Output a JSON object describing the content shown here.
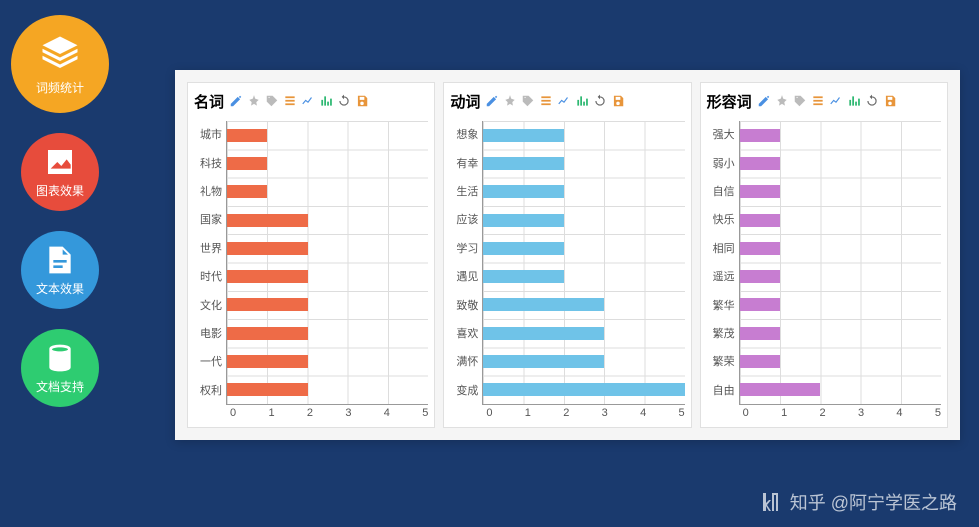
{
  "sidebar": {
    "items": [
      {
        "label": "词频统计"
      },
      {
        "label": "图表效果"
      },
      {
        "label": "文本效果"
      },
      {
        "label": "文档支持"
      }
    ]
  },
  "watermark": "知乎 @阿宁学医之路",
  "chart_data": [
    {
      "type": "bar",
      "orientation": "horizontal",
      "title": "名词",
      "categories": [
        "城市",
        "科技",
        "礼物",
        "国家",
        "世界",
        "时代",
        "文化",
        "电影",
        "一代",
        "权利"
      ],
      "values": [
        1,
        1,
        1,
        2,
        2,
        2,
        2,
        2,
        2,
        2
      ],
      "xlim": [
        0,
        5
      ],
      "xticks": [
        0,
        1,
        2,
        3,
        4,
        5
      ],
      "bar_color": "#ee6b47"
    },
    {
      "type": "bar",
      "orientation": "horizontal",
      "title": "动词",
      "categories": [
        "想象",
        "有幸",
        "生活",
        "应该",
        "学习",
        "遇见",
        "致敬",
        "喜欢",
        "满怀",
        "变成"
      ],
      "values": [
        2,
        2,
        2,
        2,
        2,
        2,
        3,
        3,
        3,
        5
      ],
      "xlim": [
        0,
        5
      ],
      "xticks": [
        0,
        1,
        2,
        3,
        4,
        5
      ],
      "bar_color": "#6fc3e8"
    },
    {
      "type": "bar",
      "orientation": "horizontal",
      "title": "形容词",
      "categories": [
        "强大",
        "弱小",
        "自信",
        "快乐",
        "相同",
        "遥远",
        "繁华",
        "繁茂",
        "繁荣",
        "自由"
      ],
      "values": [
        1,
        1,
        1,
        1,
        1,
        1,
        1,
        1,
        1,
        2
      ],
      "xlim": [
        0,
        5
      ],
      "xticks": [
        0,
        1,
        2,
        3,
        4,
        5
      ],
      "bar_color": "#c77dd1"
    }
  ],
  "toolbar_icons": [
    "edit",
    "pin",
    "tag",
    "list",
    "line-chart",
    "bar-chart",
    "refresh",
    "save"
  ]
}
